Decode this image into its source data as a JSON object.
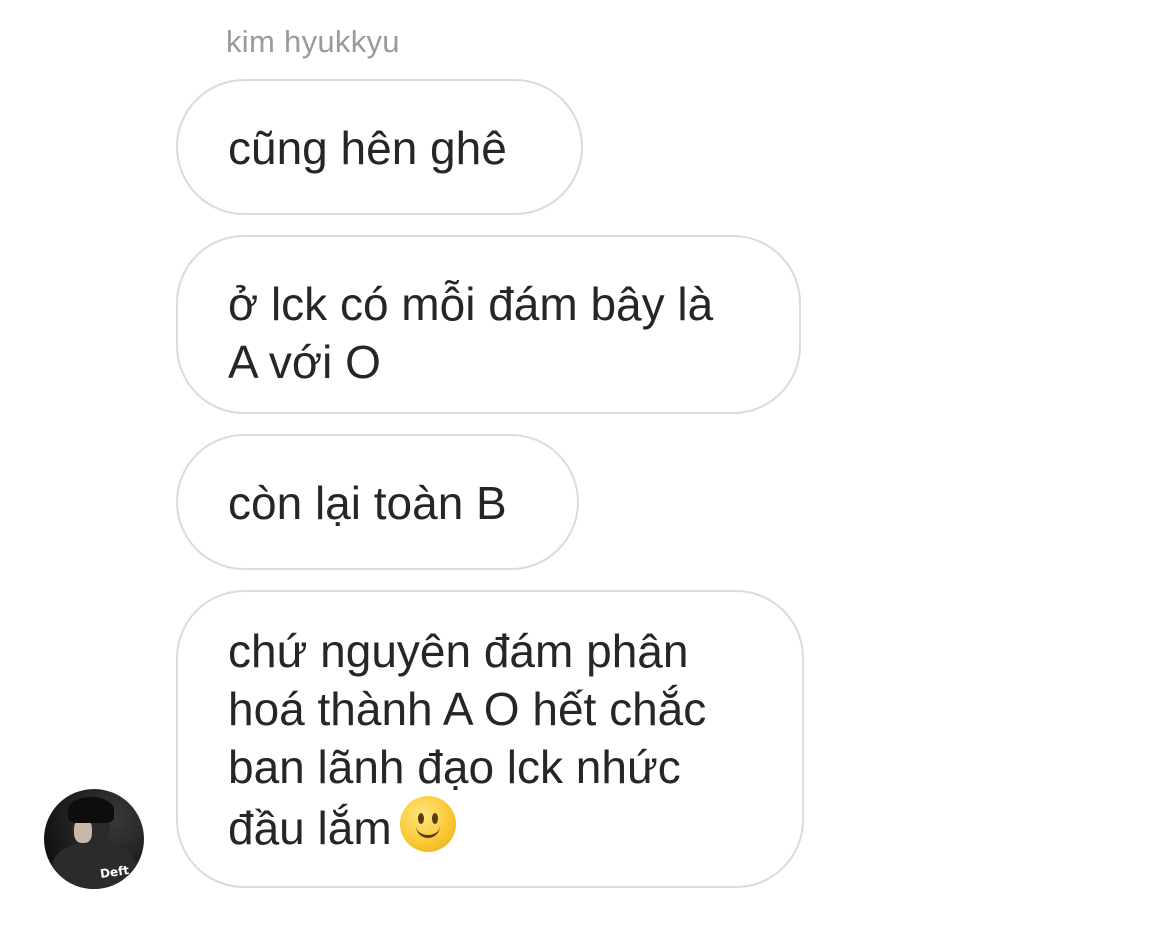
{
  "sender": {
    "name": "kim hyukkyu",
    "avatar_badge": "Deft"
  },
  "messages": [
    {
      "text": "cũng hên ghê"
    },
    {
      "text": "ở lck có mỗi đám bây là A với O"
    },
    {
      "text": "còn lại toàn B"
    },
    {
      "text": "chứ nguyên đám phân hoá thành A O hết chắc ban lãnh đạo lck nhức đầu lắm",
      "emoji": "slightly-smiling-face-icon"
    }
  ],
  "colors": {
    "bubble_border": "#dbdbdb",
    "text": "#262626",
    "sender_name": "#9a9a9a"
  }
}
